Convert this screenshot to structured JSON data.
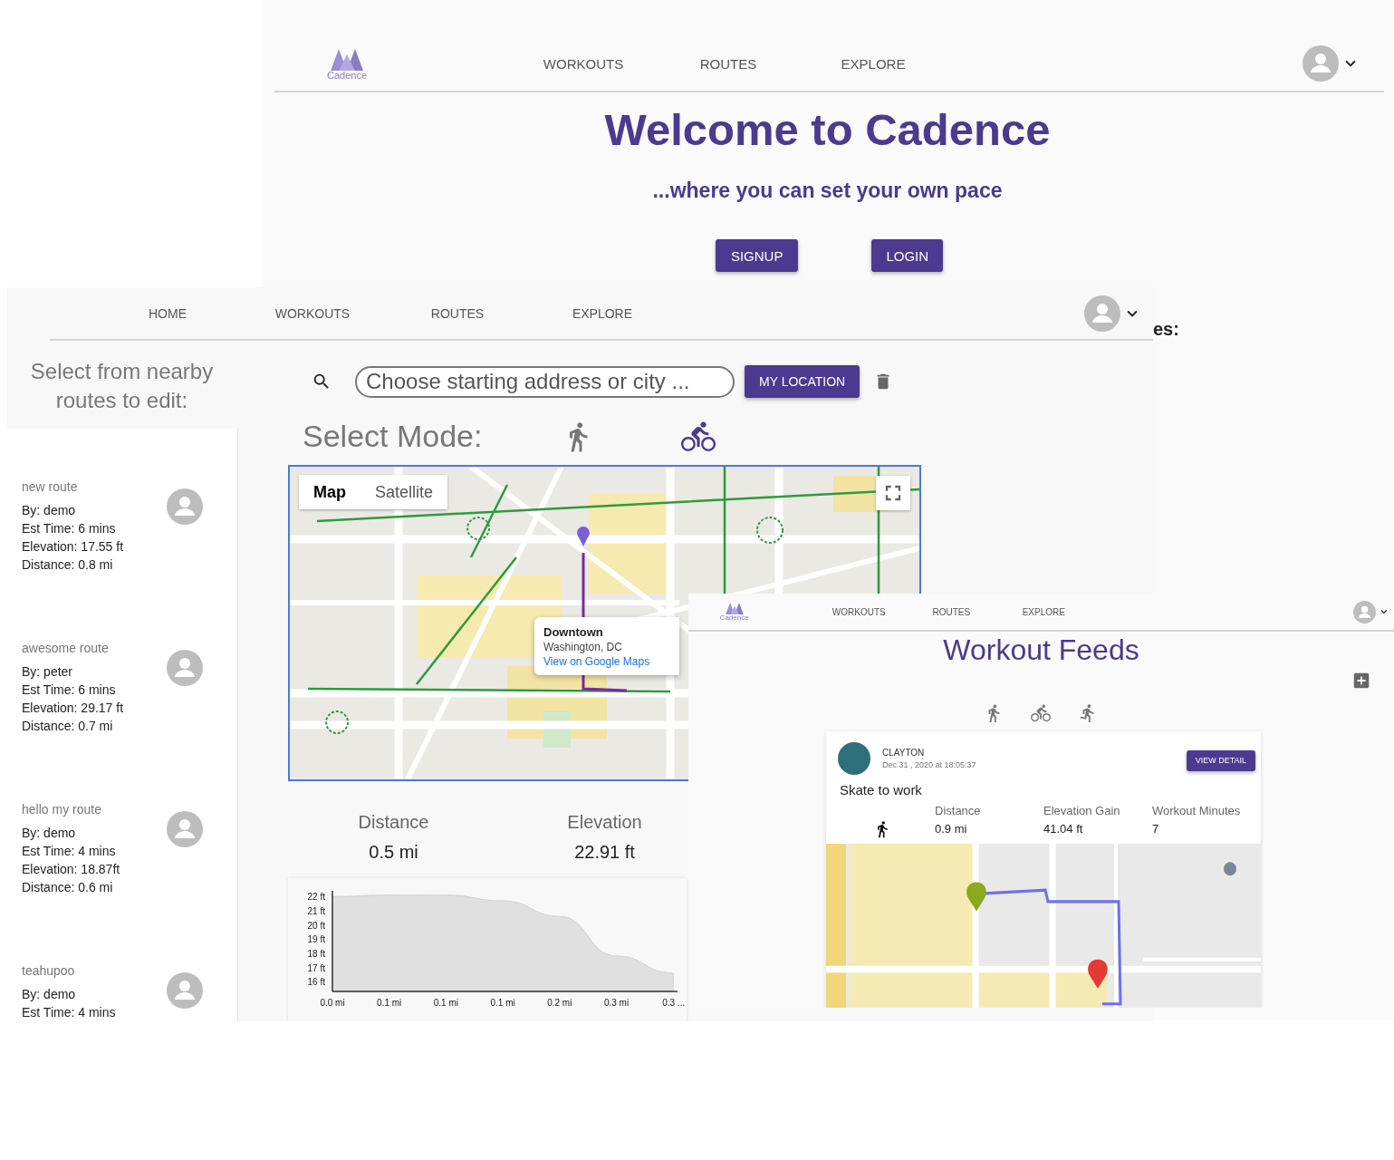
{
  "landing": {
    "nav": {
      "logo_text": "Cadence",
      "links": [
        {
          "label": "WORKOUTS"
        },
        {
          "label": "ROUTES"
        },
        {
          "label": "EXPLORE"
        }
      ]
    },
    "title": "Welcome to Cadence",
    "subtitle": "...where you can set your own pace",
    "buttons": [
      {
        "label": "SIGNUP"
      },
      {
        "label": "LOGIN"
      }
    ],
    "fragment": "es:"
  },
  "route_editor": {
    "nav": {
      "links": [
        {
          "label": "HOME"
        },
        {
          "label": "WORKOUTS"
        },
        {
          "label": "ROUTES"
        },
        {
          "label": "EXPLORE"
        }
      ]
    },
    "sidebar": {
      "heading": "Select from nearby routes to edit:",
      "routes": [
        {
          "name": "new route",
          "lines": [
            "By: demo",
            "Est Time: 6 mins",
            "Elevation: 17.55 ft",
            "Distance: 0.8 mi"
          ]
        },
        {
          "name": "awesome route",
          "lines": [
            "By: peter",
            "Est Time: 6 mins",
            "Elevation: 29.17 ft",
            "Distance: 0.7 mi"
          ]
        },
        {
          "name": "hello my route",
          "lines": [
            "By: demo",
            "Est Time: 4 mins",
            "Elevation: 18.87ft",
            "Distance: 0.6 mi"
          ]
        },
        {
          "name": "teahupoo",
          "lines": [
            "By: demo",
            "Est Time: 4 mins"
          ]
        }
      ]
    },
    "search": {
      "placeholder": "Choose starting address or city ..."
    },
    "location_button": "MY LOCATION",
    "mode": {
      "label": "Select Mode:",
      "modes": [
        {
          "kind": "walk",
          "selected": false
        },
        {
          "kind": "bike",
          "selected": true
        }
      ]
    },
    "map": {
      "kind": "picture",
      "types": [
        {
          "label": "Map",
          "selected": true
        },
        {
          "label": "Satellite",
          "selected": false
        }
      ],
      "popup": {
        "title": "Downtown",
        "subtitle": "Washington, DC",
        "link": "View on Google Maps"
      }
    },
    "stats": [
      {
        "label": "Distance",
        "value": "0.5 mi"
      },
      {
        "label": "Elevation",
        "value": "22.91 ft"
      }
    ],
    "chart_data": {
      "type": "area",
      "categories": [
        "0.0 mi",
        "0.1 mi",
        "0.1 mi",
        "0.1 mi",
        "0.2 mi",
        "0.3 mi",
        "0.3 ..."
      ],
      "series": [
        {
          "color": "#e0e0e0",
          "values": [
            22.1,
            22.2,
            22.2,
            21.8,
            20.7,
            17.9,
            16.7
          ]
        }
      ],
      "ylim": [
        15.4,
        22.5
      ],
      "yticks": [
        {
          "value": 16,
          "label": "16 ft"
        },
        {
          "value": 17,
          "label": "17 ft"
        },
        {
          "value": 18,
          "label": "18 ft"
        },
        {
          "value": 19,
          "label": "19 ft"
        },
        {
          "value": 20,
          "label": "20 ft"
        },
        {
          "value": 21,
          "label": "21 ft"
        },
        {
          "value": 22,
          "label": "22 ft"
        }
      ]
    }
  },
  "feed": {
    "nav": {
      "logo_text": "Cadence",
      "links": [
        {
          "label": "WORKOUTS"
        },
        {
          "label": "ROUTES"
        },
        {
          "label": "EXPLORE"
        }
      ]
    },
    "title": "Workout Feeds",
    "filters": [
      {
        "kind": "walk"
      },
      {
        "kind": "bike"
      },
      {
        "kind": "run"
      }
    ],
    "post": {
      "user": "CLAYTON",
      "date": "Dec 31 , 2020 at 18:05:37",
      "button": "VIEW DETAIL",
      "title": "Skate to work",
      "activity": {
        "kind": "walk"
      },
      "stats": [
        {
          "label": "Distance",
          "value": "0.9 mi"
        },
        {
          "label": "Elevation Gain",
          "value": "41.04 ft"
        },
        {
          "label": "Workout Minutes",
          "value": "7"
        }
      ]
    }
  }
}
